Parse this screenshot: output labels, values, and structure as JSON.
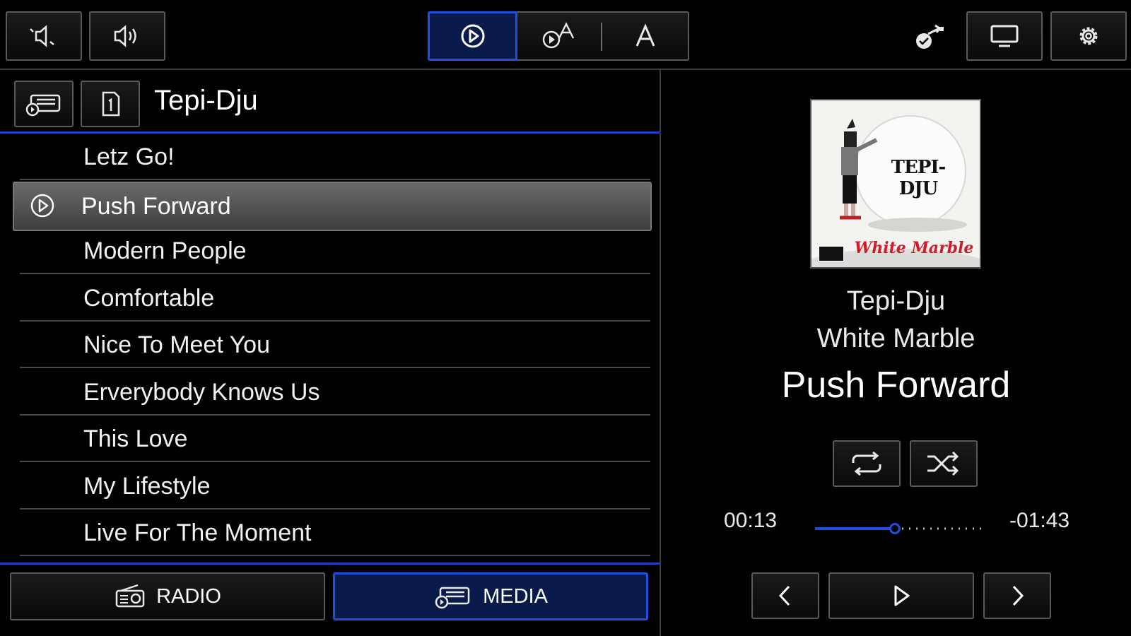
{
  "top_bar": {
    "volume_down_icon": "volume-down-icon",
    "volume_up_icon": "volume-up-icon",
    "modes": [
      "play-icon",
      "play-text-icon",
      "text-icon"
    ],
    "active_mode": 0,
    "right_icons": [
      "connection-icon",
      "screen-icon",
      "gear-icon"
    ]
  },
  "list": {
    "title": "Tepi-Dju",
    "tracks": [
      {
        "label": "Letz Go!",
        "active": false
      },
      {
        "label": "Push Forward",
        "active": true
      },
      {
        "label": "Modern People",
        "active": false
      },
      {
        "label": "Comfortable",
        "active": false
      },
      {
        "label": "Nice To Meet You",
        "active": false
      },
      {
        "label": "Erverybody Knows Us",
        "active": false
      },
      {
        "label": "This Love",
        "active": false
      },
      {
        "label": "My Lifestyle",
        "active": false
      },
      {
        "label": "Live For The Moment",
        "active": false
      }
    ]
  },
  "sources": {
    "radio_label": "RADIO",
    "media_label": "MEDIA",
    "active": "MEDIA"
  },
  "now_playing": {
    "album_art": {
      "title_text": "TEPI-DJU",
      "script_text": "White Marble"
    },
    "artist": "Tepi-Dju",
    "album": "White Marble",
    "track": "Push Forward",
    "elapsed": "00:13",
    "remaining": "-01:43",
    "progress_fraction": 0.47
  },
  "colors": {
    "accent": "#1e4fe0",
    "active_bg": "#0a1a4a",
    "background": "#000000",
    "border": "#5a5a5a"
  }
}
